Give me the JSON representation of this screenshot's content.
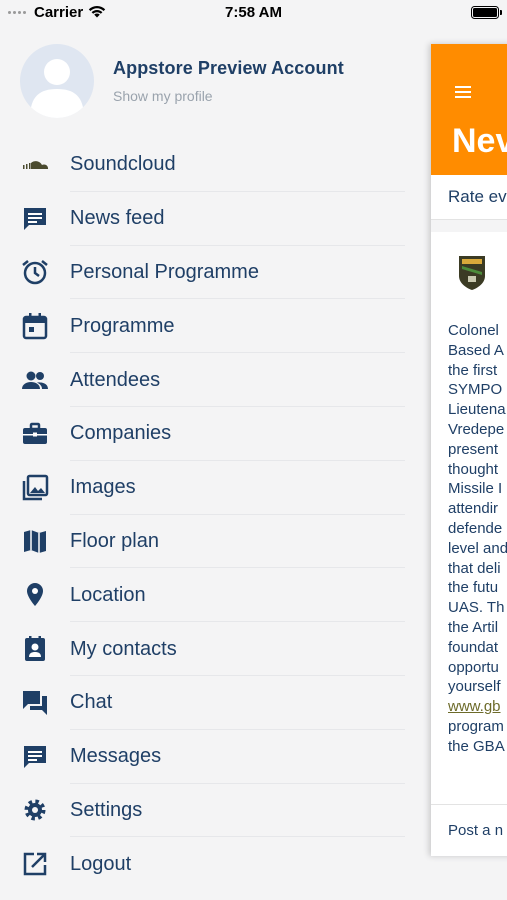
{
  "status_bar": {
    "carrier": "Carrier",
    "time": "7:58 AM"
  },
  "profile": {
    "name": "Appstore Preview Account",
    "link": "Show my profile"
  },
  "menu": {
    "items": [
      {
        "label": "Soundcloud",
        "icon": "soundcloud-icon"
      },
      {
        "label": "News feed",
        "icon": "news-feed-icon"
      },
      {
        "label": "Personal Programme",
        "icon": "alarm-clock-icon"
      },
      {
        "label": "Programme",
        "icon": "calendar-icon"
      },
      {
        "label": "Attendees",
        "icon": "people-icon"
      },
      {
        "label": "Companies",
        "icon": "briefcase-icon"
      },
      {
        "label": "Images",
        "icon": "images-icon"
      },
      {
        "label": "Floor plan",
        "icon": "map-icon"
      },
      {
        "label": "Location",
        "icon": "location-pin-icon"
      },
      {
        "label": "My contacts",
        "icon": "contact-card-icon"
      },
      {
        "label": "Chat",
        "icon": "chat-icon"
      },
      {
        "label": "Messages",
        "icon": "message-icon"
      },
      {
        "label": "Settings",
        "icon": "gear-icon"
      },
      {
        "label": "Logout",
        "icon": "logout-icon"
      }
    ]
  },
  "panel": {
    "title": "Nev",
    "rate_bar": "Rate ev",
    "article_lines": [
      "Colonel",
      "Based A",
      "the first",
      "SYMPO",
      "Lieutena",
      "Vredepe",
      "present",
      "thought",
      "Missile I",
      "attendir",
      "defende",
      "level and",
      "that deli",
      "the futu",
      "UAS. Th",
      "the Artil",
      "foundat",
      "opportu",
      "yourself"
    ],
    "article_link": "www.gb",
    "article_tail": [
      "program",
      "the GBA"
    ],
    "footer": "Post a n"
  },
  "colors": {
    "accent": "#ff8c00",
    "text": "#1f3f66",
    "background": "#f4f4f5"
  }
}
